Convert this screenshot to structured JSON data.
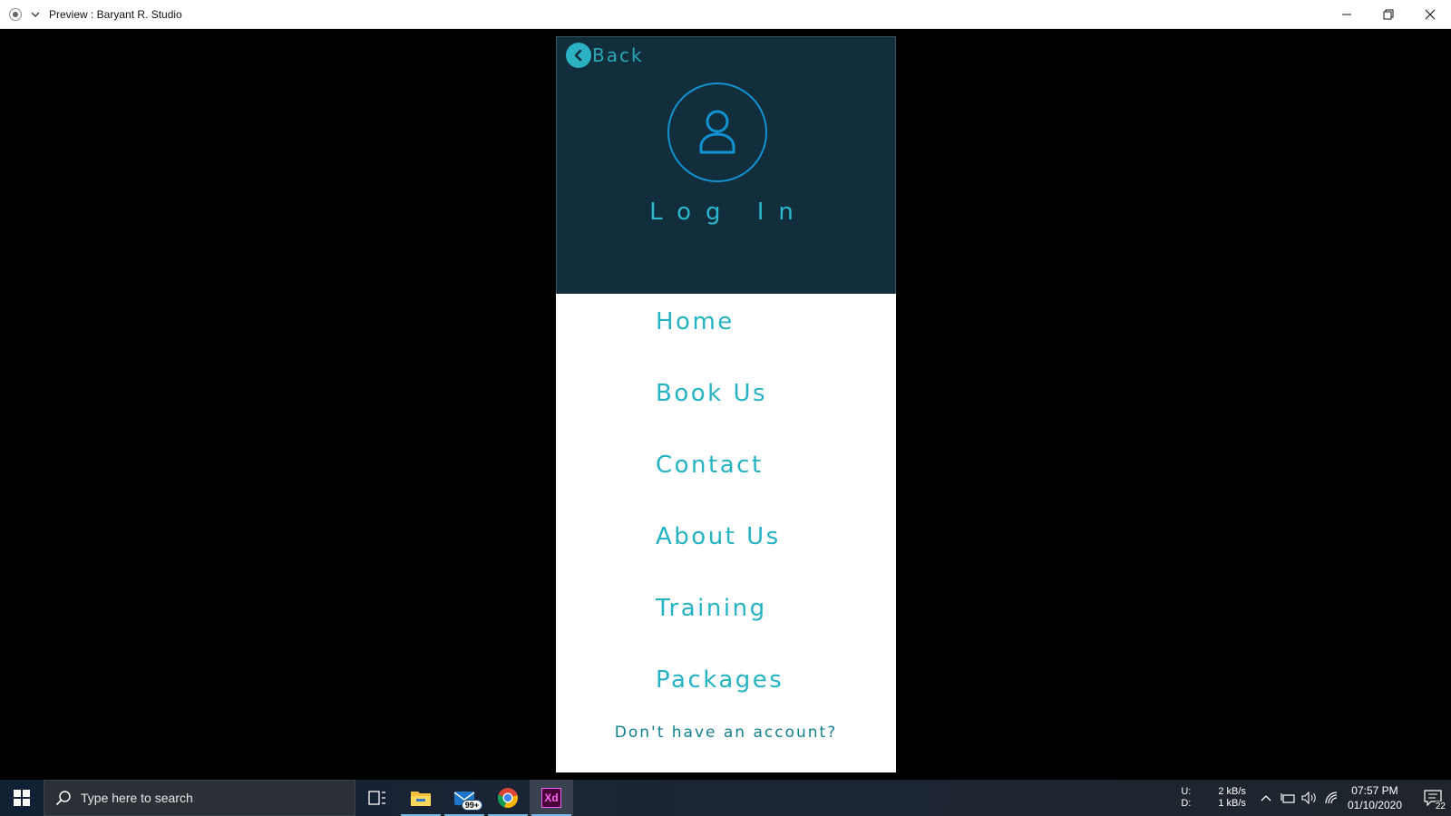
{
  "window": {
    "title": "Preview : Baryant R. Studio"
  },
  "prototype": {
    "back_label": "Back",
    "login_title": "Log In",
    "menu": [
      {
        "label": "Home"
      },
      {
        "label": "Book Us"
      },
      {
        "label": "Contact"
      },
      {
        "label": "About Us"
      },
      {
        "label": "Training"
      },
      {
        "label": "Packages"
      }
    ],
    "signup_prompt": "Don't have an account?",
    "colors": {
      "header_bg": "#122e3c",
      "accent": "#2bb1c2",
      "avatar_ring": "#1193d1",
      "body_bg": "#ffffff"
    }
  },
  "taskbar": {
    "search_placeholder": "Type here to search",
    "mail_badge": "99+",
    "xd_label": "Xd",
    "net_up_label": "U:",
    "net_down_label": "D:",
    "net_up_value": "2 kB/s",
    "net_down_value": "1 kB/s",
    "time": "07:57 PM",
    "date": "01/10/2020",
    "notification_count": "22",
    "icons": [
      "windows-start-icon",
      "search-icon",
      "task-view-icon",
      "file-explorer-icon",
      "mail-icon",
      "chrome-icon",
      "adobe-xd-icon",
      "chevron-up-icon",
      "network-adapter-icon",
      "volume-icon",
      "wifi-icon",
      "notification-icon"
    ]
  }
}
